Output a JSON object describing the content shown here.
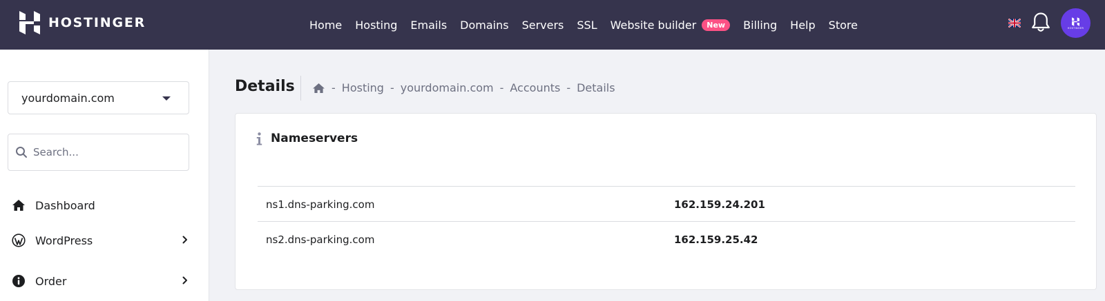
{
  "brand": {
    "name": "HOSTINGER"
  },
  "nav": {
    "items": [
      {
        "label": "Home"
      },
      {
        "label": "Hosting"
      },
      {
        "label": "Emails"
      },
      {
        "label": "Domains"
      },
      {
        "label": "Servers"
      },
      {
        "label": "SSL"
      },
      {
        "label": "Website builder",
        "badge": "New"
      },
      {
        "label": "Billing"
      },
      {
        "label": "Help"
      },
      {
        "label": "Store"
      }
    ],
    "flag_icon": "uk-flag-icon",
    "notifications_icon": "bell-icon",
    "avatar_text": "HOSTINGER"
  },
  "sidebar": {
    "domain_select": {
      "value": "yourdomain.com"
    },
    "search": {
      "placeholder": "Search..."
    },
    "items": [
      {
        "label": "Dashboard",
        "icon": "home-icon",
        "has_submenu": false
      },
      {
        "label": "WordPress",
        "icon": "wordpress-icon",
        "has_submenu": true
      },
      {
        "label": "Order",
        "icon": "info-icon",
        "has_submenu": true
      }
    ]
  },
  "page": {
    "title": "Details",
    "breadcrumb": [
      "Hosting",
      "yourdomain.com",
      "Accounts",
      "Details"
    ],
    "breadcrumb_separator": "-"
  },
  "nameservers": {
    "title": "Nameservers",
    "rows": [
      {
        "host": "ns1.dns-parking.com",
        "ip": "162.159.24.201"
      },
      {
        "host": "ns2.dns-parking.com",
        "ip": "162.159.25.42"
      }
    ]
  },
  "colors": {
    "topbar": "#36344d",
    "accent": "#673de6",
    "badge": "#fc5185",
    "background": "#f1f2f6"
  }
}
